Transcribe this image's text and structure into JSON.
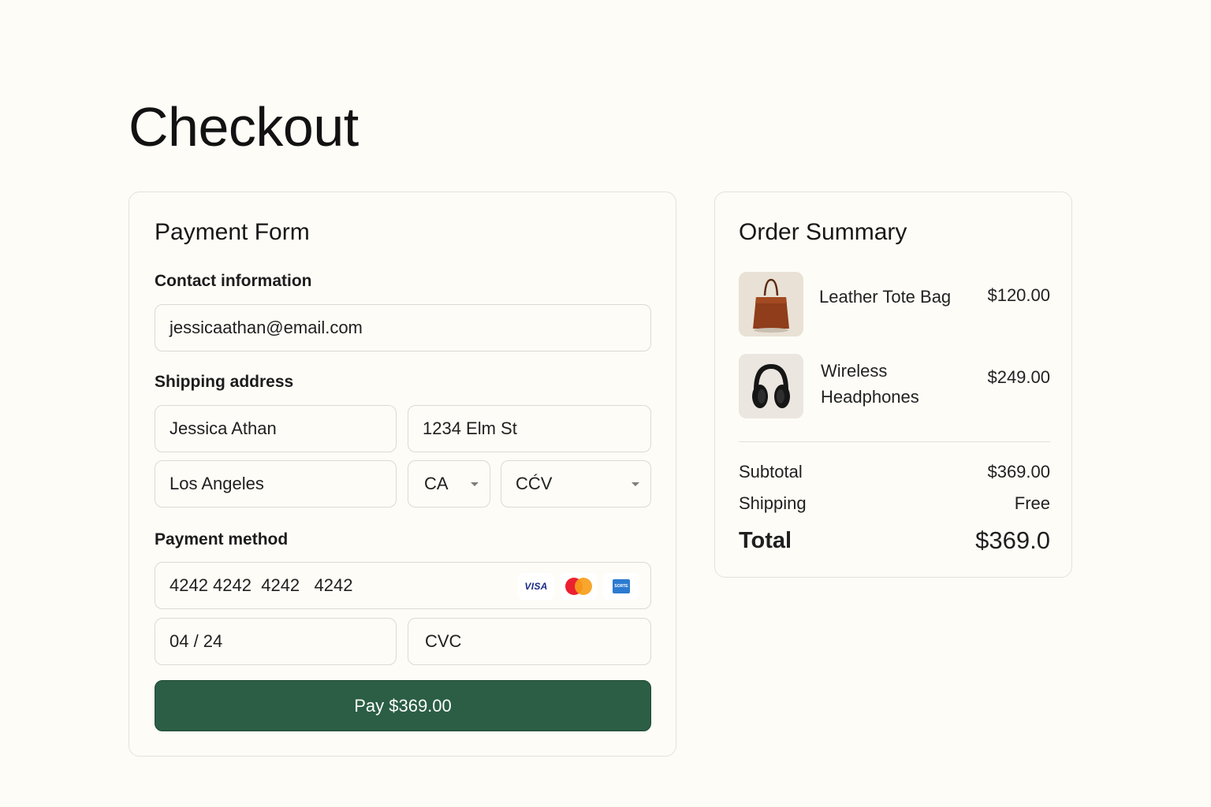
{
  "page": {
    "title": "Checkout"
  },
  "payment_form": {
    "title": "Payment Form",
    "contact": {
      "label": "Contact information",
      "email": "jessicaathan@email.com"
    },
    "shipping": {
      "label": "Shipping address",
      "name": "Jessica Athan",
      "street": "1234 Elm St",
      "city": "Los Angeles",
      "state": "CA",
      "zip": "CĆV"
    },
    "payment": {
      "label": "Payment method",
      "card_number": "4242 4242  4242   4242",
      "card_brands": [
        "visa-icon",
        "mastercard-icon",
        "card-brand-icon"
      ],
      "visa_text": "VISA",
      "brand_box_text": "SORTE",
      "expiry": "04 / 24",
      "cvc": "CVC"
    },
    "pay_button": "Pay $369.00",
    "accent_color": "#2b5e44"
  },
  "order_summary": {
    "title": "Order Summary",
    "items": [
      {
        "name": "Leather Tote Bag",
        "price": "$120.00",
        "icon": "tote-bag-icon"
      },
      {
        "name": "Wireless Headphones",
        "price": "$249.00",
        "icon": "headphones-icon"
      }
    ],
    "subtotal_label": "Subtotal",
    "subtotal": "$369.00",
    "shipping_label": "Shipping",
    "shipping": "Free",
    "total_label": "Total",
    "total": "$369.0"
  }
}
